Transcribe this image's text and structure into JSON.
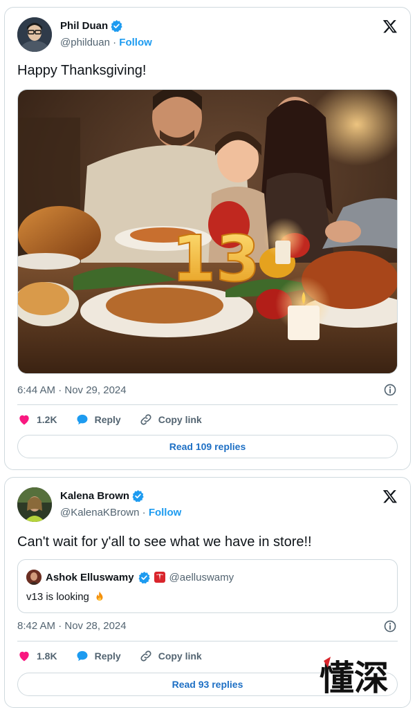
{
  "tweets": [
    {
      "author": {
        "name": "Phil Duan",
        "handle": "@philduan",
        "follow_label": "Follow"
      },
      "text": "Happy Thanksgiving!",
      "photo": {
        "overlay_text": "13"
      },
      "timestamp": "6:44 AM · Nov 29, 2024",
      "actions": {
        "likes": "1.2K",
        "reply_label": "Reply",
        "copy_link_label": "Copy link"
      },
      "read_replies_label": "Read 109 replies"
    },
    {
      "author": {
        "name": "Kalena Brown",
        "handle": "@KalenaKBrown",
        "follow_label": "Follow"
      },
      "text": "Can't wait for y'all to see what we have in store!!",
      "quote": {
        "name": "Ashok Elluswamy",
        "handle": "@aelluswamy",
        "text": "v13 is looking"
      },
      "timestamp": "8:42 AM · Nov 28, 2024",
      "actions": {
        "likes": "1.8K",
        "reply_label": "Reply",
        "copy_link_label": "Copy link"
      },
      "read_replies_label": "Read 93 replies"
    }
  ],
  "separator": "·",
  "watermark_text": "懂深",
  "colors": {
    "accent": "#1d9bf0",
    "like": "#f91880",
    "reply": "#1d9bf0",
    "read_replies_text": "#1d6fc4"
  },
  "icons": [
    "verified-badge-icon",
    "x-logo-icon",
    "heart-icon",
    "reply-bubble-icon",
    "link-icon",
    "info-icon",
    "fire-emoji-icon",
    "tesla-badge-icon"
  ]
}
